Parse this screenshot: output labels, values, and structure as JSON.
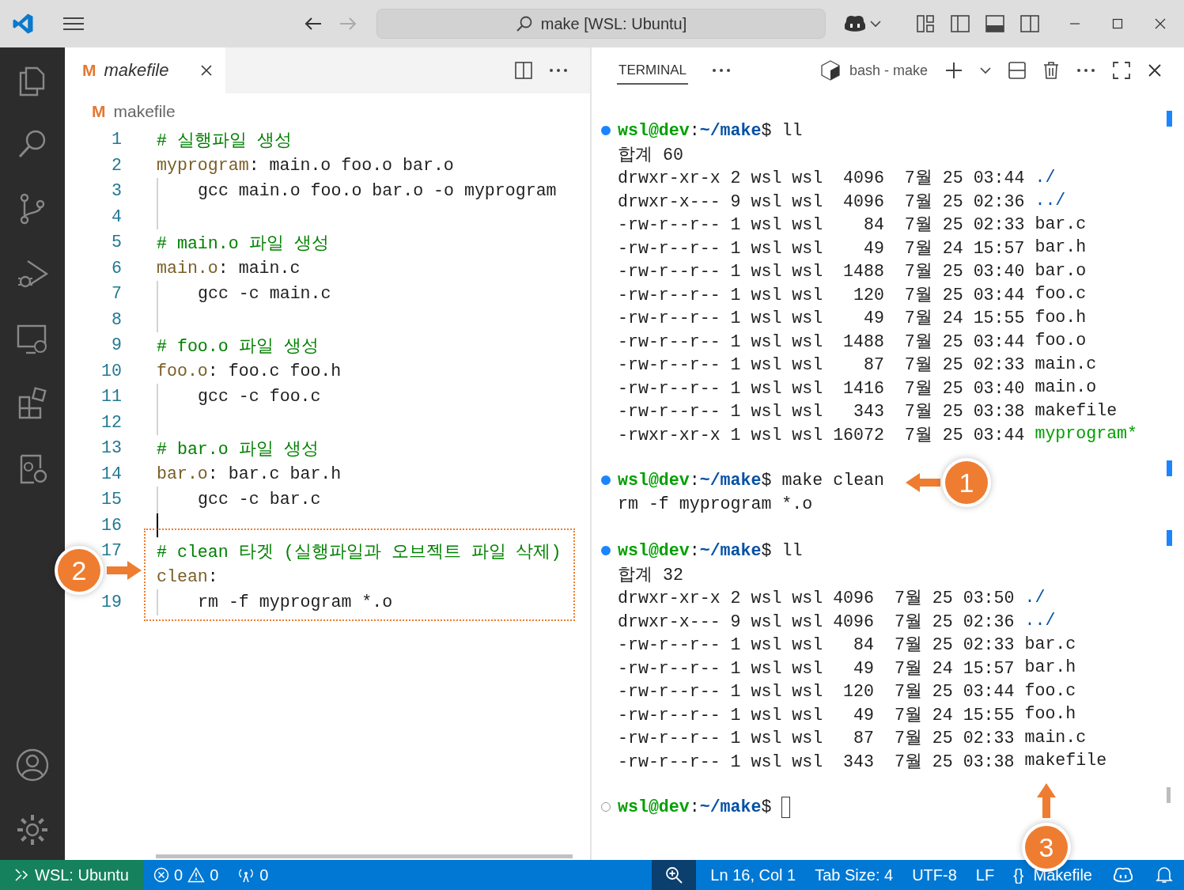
{
  "title_bar": {
    "search": "make [WSL: Ubuntu]"
  },
  "editor": {
    "tabs": [
      {
        "label": "makefile",
        "icon": "M",
        "selected": true
      }
    ],
    "breadcrumb": {
      "icon": "M",
      "label": "makefile"
    },
    "lines": [
      {
        "n": "1",
        "kind": "comment",
        "text": "# 실행파일 생성"
      },
      {
        "n": "2",
        "kind": "rule",
        "target": "myprogram",
        "sep": ":",
        "deps": "main.o foo.o bar.o"
      },
      {
        "n": "3",
        "kind": "recipe",
        "text": "gcc main.o foo.o bar.o -o myprogram"
      },
      {
        "n": "4",
        "kind": "empty",
        "guide": true
      },
      {
        "n": "5",
        "kind": "comment",
        "text": "# main.o 파일 생성"
      },
      {
        "n": "6",
        "kind": "rule",
        "target": "main.o",
        "sep": ":",
        "deps": "main.c"
      },
      {
        "n": "7",
        "kind": "recipe",
        "text": "gcc -c main.c"
      },
      {
        "n": "8",
        "kind": "empty",
        "guide": true
      },
      {
        "n": "9",
        "kind": "comment",
        "text": "# foo.o 파일 생성"
      },
      {
        "n": "10",
        "kind": "rule",
        "target": "foo.o",
        "sep": ":",
        "deps": "foo.c foo.h"
      },
      {
        "n": "11",
        "kind": "recipe",
        "text": "gcc -c foo.c"
      },
      {
        "n": "12",
        "kind": "empty",
        "guide": true
      },
      {
        "n": "13",
        "kind": "comment",
        "text": "# bar.o 파일 생성"
      },
      {
        "n": "14",
        "kind": "rule",
        "target": "bar.o",
        "sep": ":",
        "deps": "bar.c bar.h"
      },
      {
        "n": "15",
        "kind": "recipe",
        "text": "gcc -c bar.c"
      },
      {
        "n": "16",
        "kind": "empty",
        "guide": true,
        "cursor": true
      },
      {
        "n": "17",
        "kind": "comment",
        "text": "# clean 타겟 (실행파일과 오브젝트 파일 삭제)"
      },
      {
        "kind": "rule",
        "target": "clean",
        "sep": ":"
      },
      {
        "n": "19",
        "kind": "recipe",
        "text": "rm -f myprogram *.o"
      }
    ]
  },
  "terminal": {
    "tabs": [
      {
        "label": "TERMINAL",
        "selected": true
      }
    ],
    "shell": "bash - make",
    "lines": [
      {
        "kind": "prompt",
        "completed": true,
        "user": "wsl@dev",
        "sep": ":",
        "path": "~/make",
        "symbol": "$",
        "command": "ll"
      },
      {
        "kind": "output",
        "text": "합계 60"
      },
      {
        "kind": "ls",
        "text": "drwxr-xr-x 2 wsl wsl  4096  7월 25 03:44",
        "name": "./",
        "color": "#0451a5"
      },
      {
        "kind": "ls",
        "text": "drwxr-x--- 9 wsl wsl  4096  7월 25 02:36",
        "name": "../",
        "color": "#0451a5"
      },
      {
        "kind": "ls",
        "text": "-rw-r--r-- 1 wsl wsl    84  7월 25 02:33",
        "name": "bar.c",
        "color": "#1f1f1f"
      },
      {
        "kind": "ls",
        "text": "-rw-r--r-- 1 wsl wsl    49  7월 24 15:57",
        "name": "bar.h",
        "color": "#1f1f1f"
      },
      {
        "kind": "ls",
        "text": "-rw-r--r-- 1 wsl wsl  1488  7월 25 03:40",
        "name": "bar.o",
        "color": "#1f1f1f"
      },
      {
        "kind": "ls",
        "text": "-rw-r--r-- 1 wsl wsl   120  7월 25 03:44",
        "name": "foo.c",
        "color": "#1f1f1f"
      },
      {
        "kind": "ls",
        "text": "-rw-r--r-- 1 wsl wsl    49  7월 24 15:55",
        "name": "foo.h",
        "color": "#1f1f1f"
      },
      {
        "kind": "ls",
        "text": "-rw-r--r-- 1 wsl wsl  1488  7월 25 03:44",
        "name": "foo.o",
        "color": "#1f1f1f"
      },
      {
        "kind": "ls",
        "text": "-rw-r--r-- 1 wsl wsl    87  7월 25 02:33",
        "name": "main.c",
        "color": "#1f1f1f"
      },
      {
        "kind": "ls",
        "text": "-rw-r--r-- 1 wsl wsl  1416  7월 25 03:40",
        "name": "main.o",
        "color": "#1f1f1f"
      },
      {
        "kind": "ls",
        "text": "-rw-r--r-- 1 wsl wsl   343  7월 25 03:38",
        "name": "makefile",
        "color": "#1f1f1f"
      },
      {
        "kind": "ls",
        "text": "-rwxr-xr-x 1 wsl wsl 16072  7월 25 03:44",
        "name": "myprogram*",
        "color": "#00a000"
      },
      {
        "kind": "blank"
      },
      {
        "kind": "prompt",
        "completed": true,
        "user": "wsl@dev",
        "sep": ":",
        "path": "~/make",
        "symbol": "$",
        "command": "make clean"
      },
      {
        "kind": "output",
        "text": "rm -f myprogram *.o"
      },
      {
        "kind": "blank"
      },
      {
        "kind": "prompt",
        "completed": true,
        "user": "wsl@dev",
        "sep": ":",
        "path": "~/make",
        "symbol": "$",
        "command": "ll"
      },
      {
        "kind": "output",
        "text": "합계 32"
      },
      {
        "kind": "ls",
        "text": "drwxr-xr-x 2 wsl wsl 4096  7월 25 03:50",
        "name": "./",
        "color": "#0451a5"
      },
      {
        "kind": "ls",
        "text": "drwxr-x--- 9 wsl wsl 4096  7월 25 02:36",
        "name": "../",
        "color": "#0451a5"
      },
      {
        "kind": "ls",
        "text": "-rw-r--r-- 1 wsl wsl   84  7월 25 02:33",
        "name": "bar.c",
        "color": "#1f1f1f"
      },
      {
        "kind": "ls",
        "text": "-rw-r--r-- 1 wsl wsl   49  7월 24 15:57",
        "name": "bar.h",
        "color": "#1f1f1f"
      },
      {
        "kind": "ls",
        "text": "-rw-r--r-- 1 wsl wsl  120  7월 25 03:44",
        "name": "foo.c",
        "color": "#1f1f1f"
      },
      {
        "kind": "ls",
        "text": "-rw-r--r-- 1 wsl wsl   49  7월 24 15:55",
        "name": "foo.h",
        "color": "#1f1f1f"
      },
      {
        "kind": "ls",
        "text": "-rw-r--r-- 1 wsl wsl   87  7월 25 02:33",
        "name": "main.c",
        "color": "#1f1f1f"
      },
      {
        "kind": "ls",
        "text": "-rw-r--r-- 1 wsl wsl  343  7월 25 03:38",
        "name": "makefile",
        "color": "#1f1f1f"
      },
      {
        "kind": "blank"
      },
      {
        "kind": "prompt",
        "completed": false,
        "user": "wsl@dev",
        "sep": ":",
        "path": "~/make",
        "symbol": "$",
        "cursor": true
      }
    ]
  },
  "status_bar": {
    "remote": "WSL: Ubuntu",
    "errors": "0",
    "warnings": "0",
    "ports": "0",
    "position": "Ln 16, Col 1",
    "tab_size": "Tab Size: 4",
    "encoding": "UTF-8",
    "eol": "LF",
    "language_icon": "{}",
    "language": "Makefile"
  },
  "callouts": [
    {
      "number": "1",
      "kind": "left"
    },
    {
      "number": "2",
      "kind": "right"
    },
    {
      "number": "3",
      "kind": "up"
    }
  ]
}
